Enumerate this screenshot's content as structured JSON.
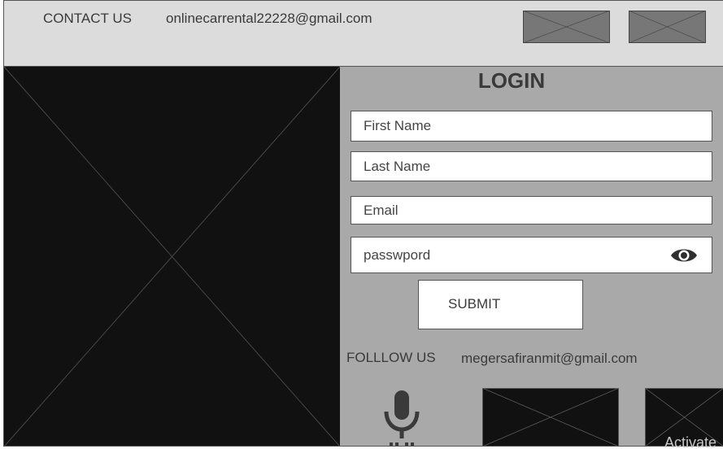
{
  "header": {
    "contact_label": "CONTACT US",
    "contact_email": "onlinecarrental22228@gmail.com"
  },
  "login": {
    "title": "LOGIN",
    "first_name_placeholder": "First Name",
    "last_name_placeholder": "Last Name",
    "email_placeholder": "Email",
    "password_placeholder": "passwpord",
    "submit_label": "SUBMIT"
  },
  "footer": {
    "follow_label": "FOLLLOW US",
    "follow_email": "megersafiranmit@gmail.com"
  },
  "watermark": "Activate",
  "icons": {
    "password_toggle": "eye-icon",
    "voice": "microphone-icon"
  },
  "colors": {
    "header_bg": "#dcdcdc",
    "panel_bg": "#a9a9a9",
    "image_dark": "#111111",
    "image_gray": "#777777"
  }
}
